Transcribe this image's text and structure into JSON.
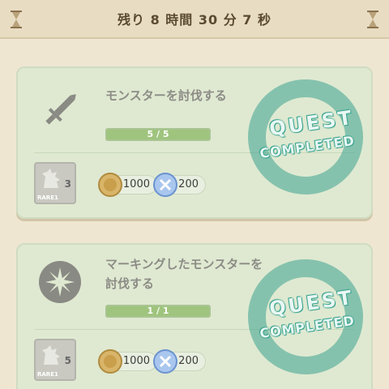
{
  "header": {
    "timer_text": "残り 8 時間 30 分 7 秒"
  },
  "quests": [
    {
      "title": "モンスターを討伐する",
      "progress_text": "5 / 5",
      "progress_fraction": 1.0,
      "rare_label": "RARE1",
      "rare_count": "3",
      "gold_amount": "1000",
      "gem_amount": "200",
      "stamp_line1": "QUEST",
      "stamp_line2": "COMPLETED",
      "icon": "sword-icon"
    },
    {
      "title": "マーキングしたモンスターを討伐する",
      "progress_text": "1 / 1",
      "progress_fraction": 1.0,
      "rare_label": "RARE1",
      "rare_count": "5",
      "gold_amount": "1000",
      "gem_amount": "200",
      "stamp_line1": "QUEST",
      "stamp_line2": "COMPLETED",
      "icon": "marker-icon"
    }
  ],
  "colors": {
    "background": "#efe6d2",
    "card": "#dfe9d1",
    "stamp": "#3aa38f",
    "progress_fill": "#9fc47d"
  }
}
